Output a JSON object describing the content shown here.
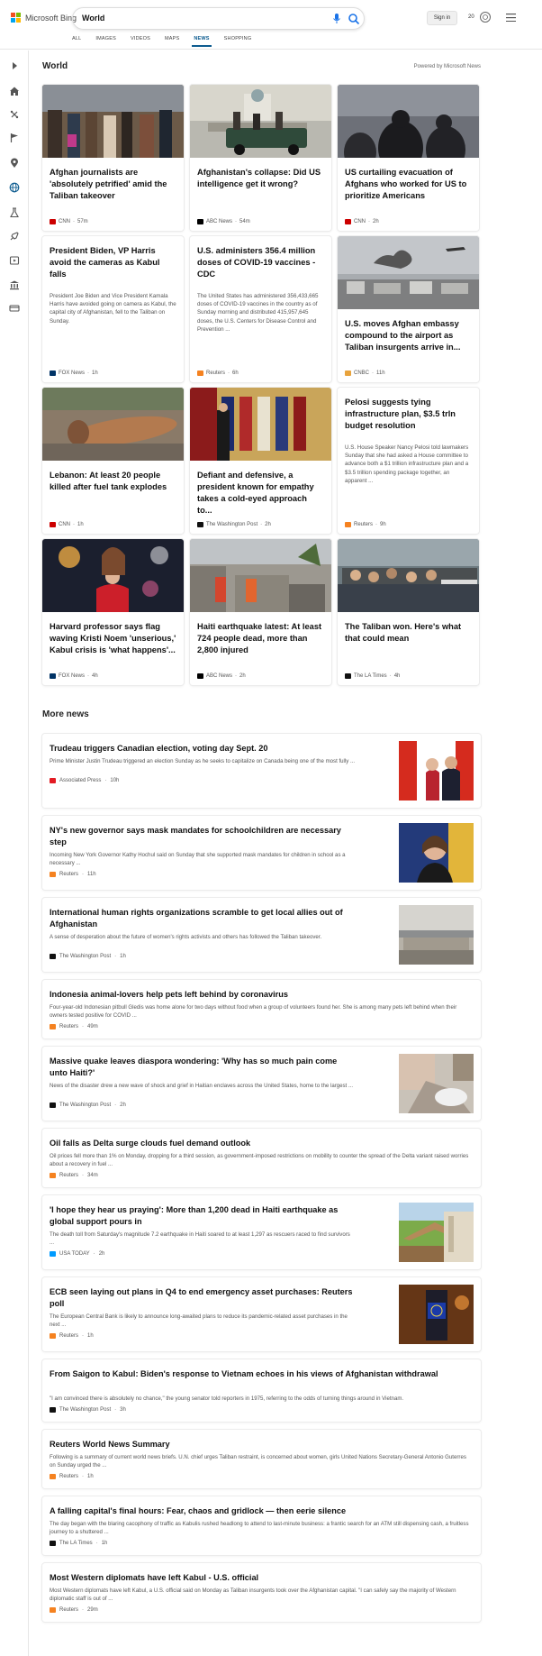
{
  "header": {
    "logo_text": "Microsoft Bing",
    "search_value": "World",
    "signin_label": "Sign in",
    "points": "20",
    "tabs": [
      {
        "label": "ALL",
        "active": false
      },
      {
        "label": "IMAGES",
        "active": false
      },
      {
        "label": "VIDEOS",
        "active": false
      },
      {
        "label": "MAPS",
        "active": false
      },
      {
        "label": "NEWS",
        "active": true
      },
      {
        "label": "SHOPPING",
        "active": false
      }
    ]
  },
  "sidebar": {
    "icons": [
      "expand-arrow-icon",
      "home-icon",
      "discover-icon",
      "flag-icon",
      "location-icon",
      "world-icon",
      "science-icon",
      "technology-icon",
      "entertainment-icon",
      "politics-icon",
      "money-icon"
    ]
  },
  "section": {
    "title": "World",
    "powered_by": "Powered by Microsoft News"
  },
  "cards": [
    {
      "title": "Afghan journalists are 'absolutely petrified' amid the Taliban takeover",
      "body": "",
      "source": "CNN",
      "time": "57m",
      "logo_color": "#cc0000"
    },
    {
      "title": "Afghanistan's collapse: Did US intelligence get it wrong?",
      "body": "",
      "source": "ABC News",
      "time": "54m",
      "logo_color": "#000000"
    },
    {
      "title": "US curtailing evacuation of Afghans who worked for US to prioritize Americans",
      "body": "",
      "source": "CNN",
      "time": "2h",
      "logo_color": "#cc0000"
    },
    {
      "title": "President Biden, VP Harris avoid the cameras as Kabul falls",
      "body": "President Joe Biden and Vice President Kamala Harris have avoided going on camera as Kabul, the capital city of Afghanistan, fell to the Taliban on Sunday.",
      "source": "FOX News",
      "time": "1h",
      "logo_color": "#003366"
    },
    {
      "title": "U.S. administers 356.4 million doses of COVID-19 vaccines - CDC",
      "body": "The United States has administered 356,433,665 doses of COVID-19 vaccines in the country as of Sunday morning and distributed 415,957,645 doses, the U.S. Centers for Disease Control and Prevention ...",
      "source": "Reuters",
      "time": "6h",
      "logo_color": "#f58220"
    },
    {
      "title": "U.S. moves Afghan embassy compound to the airport as Taliban insurgents arrive in...",
      "body": "",
      "source": "CNBC",
      "time": "11h",
      "logo_color": "#e8a33d"
    },
    {
      "title": "Lebanon: At least 20 people killed after fuel tank explodes",
      "body": "",
      "source": "CNN",
      "time": "1h",
      "logo_color": "#cc0000"
    },
    {
      "title": "Defiant and defensive, a president known for empathy takes a cold-eyed approach to...",
      "body": "",
      "source": "The Washington Post",
      "time": "2h",
      "logo_color": "#111111"
    },
    {
      "title": "Pelosi suggests tying infrastructure plan, $3.5 trln budget resolution",
      "body": "U.S. House Speaker Nancy Pelosi told lawmakers Sunday that she had asked a House committee to advance both a $1 trillion infrastructure plan and a $3.5 trillion spending package together, an apparent ...",
      "source": "Reuters",
      "time": "9h",
      "logo_color": "#f58220"
    },
    {
      "title": "Harvard professor says flag waving Kristi Noem 'unserious,' Kabul crisis is 'what happens'...",
      "body": "",
      "source": "FOX News",
      "time": "4h",
      "logo_color": "#003366"
    },
    {
      "title": "Haiti earthquake latest: At least 724 people dead, more than 2,800 injured",
      "body": "",
      "source": "ABC News",
      "time": "2h",
      "logo_color": "#000000"
    },
    {
      "title": "The Taliban won. Here's what that could mean",
      "body": "",
      "source": "The LA Times",
      "time": "4h",
      "logo_color": "#111111"
    }
  ],
  "more_news": {
    "title": "More news",
    "items": [
      {
        "title": "Trudeau triggers Canadian election, voting day Sept. 20",
        "body": "Prime Minister Justin Trudeau triggered an election Sunday as he seeks to capitalize on Canada being one of the most fully ...",
        "source": "Associated Press",
        "time": "10h",
        "logo_color": "#e31b23",
        "thumb": true
      },
      {
        "title": "NY's new governor says mask mandates for schoolchildren are necessary step",
        "body": "Incoming New York Governor Kathy Hochul said on Sunday that she supported mask mandates for children in school as a necessary ...",
        "source": "Reuters",
        "time": "11h",
        "logo_color": "#f58220",
        "thumb": true
      },
      {
        "title": "International human rights organizations scramble to get local allies out of Afghanistan",
        "body": "A sense of desperation about the future of women's rights activists and others has followed the Taliban takeover.",
        "source": "The Washington Post",
        "time": "1h",
        "logo_color": "#111111",
        "thumb": true
      },
      {
        "title": "Indonesia animal-lovers help pets left behind by coronavirus",
        "body": "Four-year-old Indonesian pitbull Gledis was home alone for two days without food when a group of volunteers found her. She is among many pets left behind when their owners tested positive for COVID ...",
        "source": "Reuters",
        "time": "49m",
        "logo_color": "#f58220",
        "thumb": false
      },
      {
        "title": "Massive quake leaves diaspora wondering: 'Why has so much pain come unto Haiti?'",
        "body": "News of the disaster drew a new wave of shock and grief in Haitian enclaves across the United States, home to the largest ...",
        "source": "The Washington Post",
        "time": "2h",
        "logo_color": "#111111",
        "thumb": true
      },
      {
        "title": "Oil falls as Delta surge clouds fuel demand outlook",
        "body": "Oil prices fell more than 1% on Monday, dropping for a third session, as government-imposed restrictions on mobility to counter the spread of the Delta variant raised worries about a recovery in fuel ...",
        "source": "Reuters",
        "time": "34m",
        "logo_color": "#f58220",
        "thumb": false
      },
      {
        "title": "'I hope they hear us praying': More than 1,200 dead in Haiti earthquake as global support pours in",
        "body": "The death toll from Saturday's magnitude 7.2 earthquake in Haiti soared to at least 1,297 as rescuers raced to find survivors ...",
        "source": "USA TODAY",
        "time": "2h",
        "logo_color": "#009bff",
        "thumb": true
      },
      {
        "title": "ECB seen laying out plans in Q4 to end emergency asset purchases: Reuters poll",
        "body": "The European Central Bank is likely to announce long-awaited plans to reduce its pandemic-related asset purchases in the next ...",
        "source": "Reuters",
        "time": "1h",
        "logo_color": "#f58220",
        "thumb": true
      },
      {
        "title": "From Saigon to Kabul: Biden's response to Vietnam echoes in his views of Afghanistan withdrawal",
        "body": "\"I am convinced there is absolutely no chance,\" the young senator told reporters in 1975, referring to the odds of turning things around in Vietnam.",
        "source": "The Washington Post",
        "time": "3h",
        "logo_color": "#111111",
        "thumb": false
      },
      {
        "title": "Reuters World News Summary",
        "body": "Following is a summary of current world news briefs. U.N. chief urges Taliban restraint, is concerned about women, girls United Nations Secretary-General Antonio Guterres on Sunday urged the ...",
        "source": "Reuters",
        "time": "1h",
        "logo_color": "#f58220",
        "thumb": false
      },
      {
        "title": "A falling capital's final hours: Fear, chaos and gridlock — then eerie silence",
        "body": "The day began with the blaring cacophony of traffic as Kabulis rushed headlong to attend to last-minute business: a frantic search for an ATM still dispensing cash, a fruitless journey to a shuttered ...",
        "source": "The LA Times",
        "time": "1h",
        "logo_color": "#111111",
        "thumb": false
      },
      {
        "title": "Most Western diplomats have left Kabul - U.S. official",
        "body": "Most Western diplomats have left Kabul, a U.S. official said on Monday as Taliban insurgents took over the Afghanistan capital. \"I can safely say the majority of Western diplomatic staff is out of ...",
        "source": "Reuters",
        "time": "29m",
        "logo_color": "#f58220",
        "thumb": false
      }
    ]
  },
  "colors": {
    "accent": "#0c5b8f",
    "logo_red": "#f25022",
    "logo_green": "#7fba00",
    "logo_blue": "#00a4ef",
    "logo_yellow": "#ffb900"
  }
}
